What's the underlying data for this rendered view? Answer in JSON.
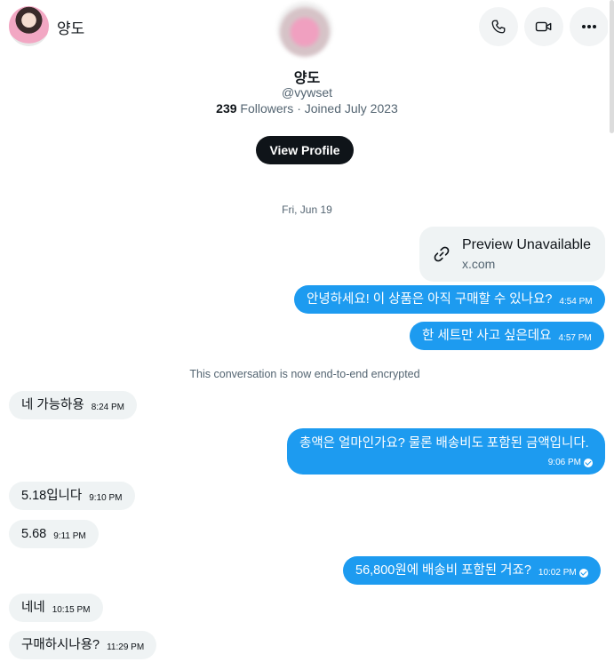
{
  "header": {
    "name": "양도",
    "icons": [
      "phone-icon",
      "video-icon",
      "more-icon"
    ]
  },
  "profile": {
    "name": "양도",
    "handle": "@vywset",
    "followers_count": "239",
    "followers_label": " Followers · Joined July 2023",
    "view_profile_label": "View Profile"
  },
  "date_separator": "Fri, Jun 19",
  "link_card": {
    "title": "Preview Unavailable",
    "domain": "x.com"
  },
  "encryption_notice": "This conversation is now end-to-end encrypted",
  "messages": [
    {
      "dir": "out",
      "text": "안녕하세요! 이 상품은 아직 구매할 수 있나요?",
      "time": "4:54 PM"
    },
    {
      "dir": "out",
      "text": "한 세트만 사고 싶은데요",
      "time": "4:57 PM"
    },
    {
      "dir": "in",
      "text": "네 가능하용",
      "time": "8:24 PM"
    },
    {
      "dir": "out",
      "text": "총액은 얼마인가요? 물론 배송비도 포함된 금액입니다.",
      "time": "9:06 PM"
    },
    {
      "dir": "in",
      "text": "5.18입니다",
      "time": "9:10 PM"
    },
    {
      "dir": "in",
      "text": "5.68",
      "time": "9:11 PM"
    },
    {
      "dir": "out",
      "text": "56,800원에 배송비 포함된 거죠?",
      "time": "10:02 PM"
    },
    {
      "dir": "in",
      "text": "네네",
      "time": "10:15 PM"
    },
    {
      "dir": "in",
      "text": "구매하시나용?",
      "time": "11:29 PM"
    }
  ],
  "colors": {
    "outgoing_bubble": "#1d9bf0",
    "incoming_bubble": "#eff3f4",
    "button_dark": "#0f1419"
  }
}
